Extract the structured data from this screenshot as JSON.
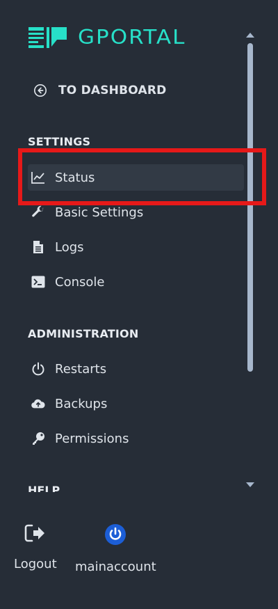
{
  "brand": {
    "name": "GPORTAL",
    "accent": "#27e0c8"
  },
  "dashboard_link": {
    "label": "TO DASHBOARD",
    "icon": "arrow-left-circle-icon"
  },
  "sections": {
    "settings": {
      "title": "SETTINGS",
      "items": [
        {
          "label": "Status",
          "icon": "chart-line-icon",
          "active": true
        },
        {
          "label": "Basic Settings",
          "icon": "wrench-icon"
        },
        {
          "label": "Logs",
          "icon": "file-text-icon"
        },
        {
          "label": "Console",
          "icon": "terminal-icon"
        }
      ]
    },
    "administration": {
      "title": "ADMINISTRATION",
      "items": [
        {
          "label": "Restarts",
          "icon": "power-icon"
        },
        {
          "label": "Backups",
          "icon": "cloud-upload-icon"
        },
        {
          "label": "Permissions",
          "icon": "key-icon"
        }
      ]
    },
    "help": {
      "title": "HELP"
    }
  },
  "footer": {
    "logout": {
      "label": "Logout",
      "icon": "logout-icon"
    },
    "account": {
      "label": "mainaccount",
      "icon": "account-power-icon",
      "color": "#1c5ed6"
    }
  },
  "colors": {
    "background": "#262d37",
    "active_item": "#323a45",
    "highlight": "#e61919",
    "scrollbar": "#a7b7cc"
  }
}
